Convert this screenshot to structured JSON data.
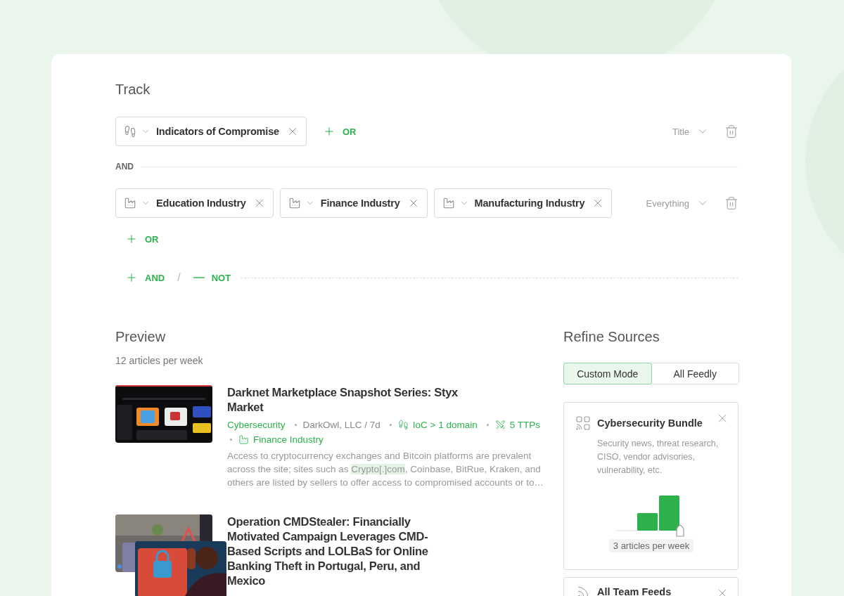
{
  "track": {
    "title": "Track",
    "groups": [
      {
        "chips": [
          {
            "kind": "ioc",
            "label": "Indicators of Compromise"
          }
        ],
        "or_label": "OR",
        "field": "Title"
      },
      {
        "chips": [
          {
            "kind": "industry",
            "label": "Education Industry"
          },
          {
            "kind": "industry",
            "label": "Finance Industry"
          },
          {
            "kind": "industry",
            "label": "Manufacturing Industry"
          }
        ],
        "or_label": "OR",
        "field": "Everything"
      }
    ],
    "connector": "AND",
    "add_and": "AND",
    "separator": "/",
    "add_not": "NOT"
  },
  "preview": {
    "title": "Preview",
    "subtitle": "12 articles per week",
    "articles": [
      {
        "title": "Darknet Marketplace Snapshot Series: Styx Market",
        "meta": [
          {
            "kind": "topic",
            "text": "Cybersecurity"
          },
          {
            "kind": "source",
            "text": "DarkOwl, LLC / 7d"
          },
          {
            "kind": "ioc",
            "text": "IoC > 1 domain"
          },
          {
            "kind": "ttp",
            "text": "5 TTPs"
          },
          {
            "kind": "industry",
            "text": "Finance Industry"
          }
        ],
        "excerpt": {
          "before": "Access to cryptocurrency exchanges and Bitcoin platforms are prevalent across the site; sites such as ",
          "highlighted": "Crypto[.]com",
          "after": ", Coinbase, BitRue, Kraken, and others are listed by sellers to offer access to compromised accounts or to…"
        }
      },
      {
        "title": "Operation CMDStealer: Financially Motivated Campaign Leverages CMD-Based Scripts and LOLBaS for Online Banking Theft in Portugal, Peru, and Mexico"
      }
    ]
  },
  "refine": {
    "title": "Refine Sources",
    "modes": [
      {
        "label": "Custom Mode",
        "selected": true
      },
      {
        "label": "All Feedly",
        "selected": false
      }
    ],
    "sources": [
      {
        "kind": "bundle",
        "name": "Cybersecurity Bundle",
        "description": "Security news, threat research, CISO, vendor advisories, vulnerability, etc.",
        "volume": "3 articles per week"
      },
      {
        "kind": "feeds",
        "name": "All Team Feeds"
      }
    ]
  }
}
